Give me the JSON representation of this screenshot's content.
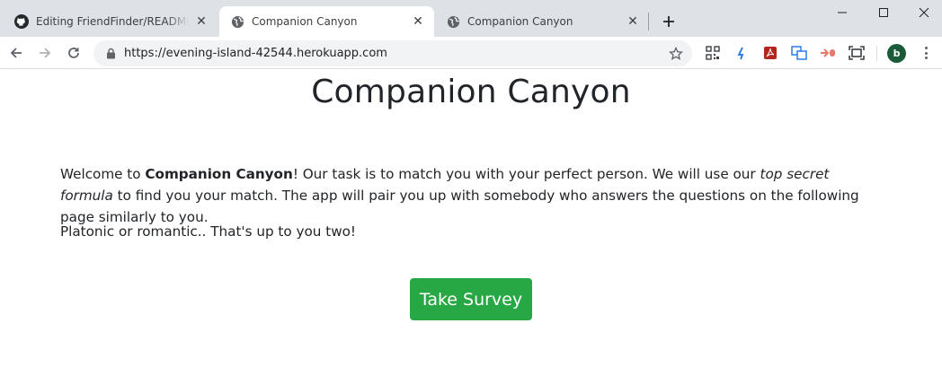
{
  "browser": {
    "tabs": [
      {
        "title": "Editing FriendFinder/README.md",
        "icon": "github-icon",
        "active": false
      },
      {
        "title": "Companion Canyon",
        "icon": "globe-icon",
        "active": true
      },
      {
        "title": "Companion Canyon",
        "icon": "globe-icon",
        "active": false
      }
    ],
    "new_tab_icon": "plus-icon",
    "window_controls": [
      "minimize-icon",
      "maximize-icon",
      "close-icon"
    ],
    "url": "https://evening-island-42544.herokuapp.com",
    "extensions": [
      "qr-code-icon",
      "extension-arrow-icon",
      "pdf-icon",
      "translate-icon",
      "cast-icon",
      "screenshot-icon"
    ],
    "profile_initial": "b",
    "profile_color": "#1a5c3a"
  },
  "page": {
    "title": "Companion Canyon",
    "intro": {
      "part1": "Welcome to ",
      "brand": "Companion Canyon",
      "part2": "! Our task is to match you with your perfect person. We will use our ",
      "emphasis": "top secret formula",
      "part3": " to find you your match. The app will pair you up with somebody who answers the questions on the following page similarly to you."
    },
    "tagline": "Platonic or romantic.. That's up to you two!",
    "survey_button": "Take Survey",
    "accent_color": "#28a745"
  }
}
